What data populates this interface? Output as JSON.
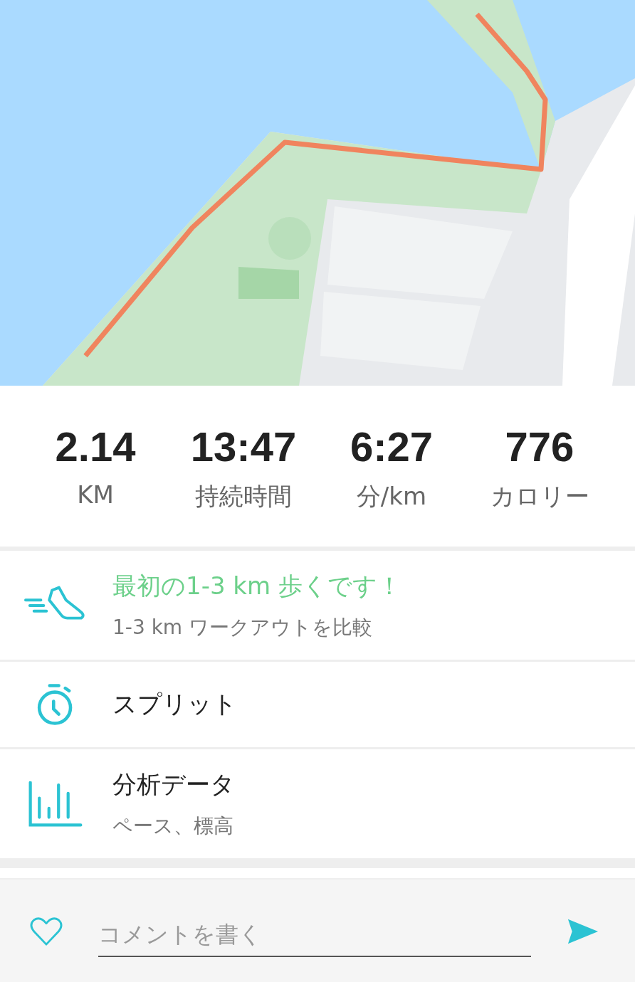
{
  "stats": [
    {
      "value": "2.14",
      "label": "KM"
    },
    {
      "value": "13:47",
      "label": "持続時間"
    },
    {
      "value": "6:27",
      "label": "分/km"
    },
    {
      "value": "776",
      "label": "カロリー"
    }
  ],
  "rows": [
    {
      "kind": "achievement",
      "title": "最初の1-3 km 歩くです！",
      "subtitle": "1-3 km ワークアウトを比較"
    },
    {
      "kind": "splits",
      "title": "スプリット"
    },
    {
      "kind": "analysis",
      "title": "分析データ",
      "subtitle": "ペース、標高"
    }
  ],
  "comment": {
    "placeholder": "コメントを書く",
    "liked": false
  }
}
